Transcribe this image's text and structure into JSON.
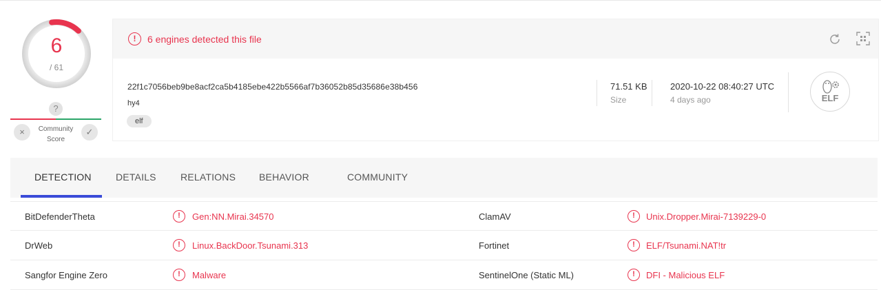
{
  "score": {
    "detections": "6",
    "total": "/ 61",
    "arc_fraction": 0.098
  },
  "community": {
    "question": "?",
    "label_line1": "Community",
    "label_line2": "Score",
    "down_icon": "×",
    "up_icon": "✓"
  },
  "alert": {
    "icon": "!",
    "text": "6 engines detected this file"
  },
  "file": {
    "hash": "22f1c7056beb9be8acf2ca5b4185ebe422b5566af7b36052b85d35686e38b456",
    "name": "hy4",
    "tag": "elf",
    "size_value": "71.51 KB",
    "size_label": "Size",
    "date_value": "2020-10-22 08:40:27 UTC",
    "date_label": "4 days ago",
    "type_badge": "ELF"
  },
  "tabs": [
    "DETECTION",
    "DETAILS",
    "RELATIONS",
    "BEHAVIOR",
    "COMMUNITY"
  ],
  "detections": [
    {
      "engine_left": "BitDefenderTheta",
      "result_left": "Gen:NN.Mirai.34570",
      "engine_right": "ClamAV",
      "result_right": "Unix.Dropper.Mirai-7139229-0"
    },
    {
      "engine_left": "DrWeb",
      "result_left": "Linux.BackDoor.Tsunami.313",
      "engine_right": "Fortinet",
      "result_right": "ELF/Tsunami.NAT!tr"
    },
    {
      "engine_left": "Sangfor Engine Zero",
      "result_left": "Malware",
      "engine_right": "SentinelOne (Static ML)",
      "result_right": "DFI - Malicious ELF"
    }
  ],
  "colors": {
    "alert": "#e8344e",
    "accent_tab": "#3a4bd8",
    "community_good": "#2aa568"
  }
}
